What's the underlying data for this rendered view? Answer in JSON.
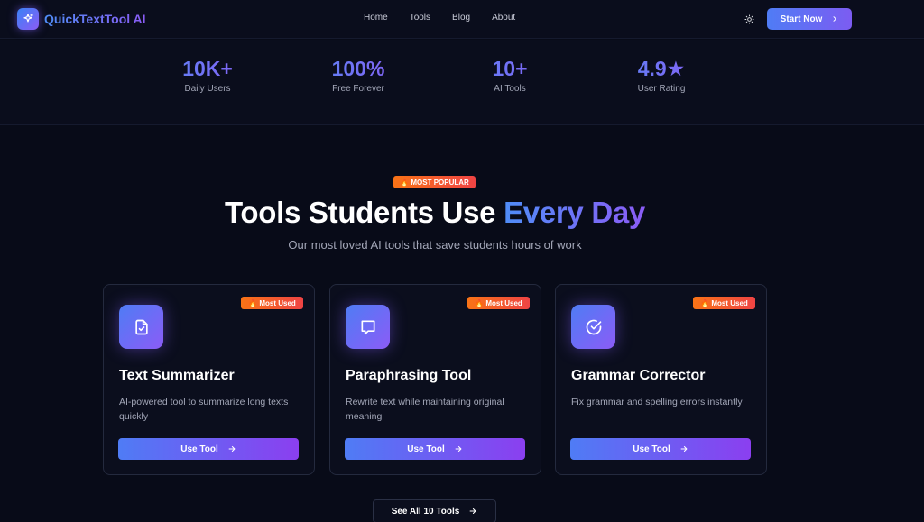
{
  "nav": {
    "brand": "QuickTextTool AI",
    "links": [
      "Home",
      "Tools",
      "Blog",
      "About"
    ],
    "cta_label": "Start Now"
  },
  "stats": [
    {
      "value": "10K+",
      "label": "Daily Users"
    },
    {
      "value": "100%",
      "label": "Free Forever"
    },
    {
      "value": "10+",
      "label": "AI Tools"
    },
    {
      "value": "4.9★",
      "label": "User Rating"
    }
  ],
  "hero": {
    "badge": "🔥 MOST POPULAR",
    "title_main": "Tools Students Use ",
    "title_accent": "Every Day",
    "subtitle": "Our most loved AI tools that save students hours of work"
  },
  "cards": [
    {
      "badge": "🔥 Most Used",
      "title": "Text Summarizer",
      "desc": "AI-powered tool to summarize long texts quickly",
      "button": "Use Tool",
      "icon": "document-check-icon"
    },
    {
      "badge": "🔥 Most Used",
      "title": "Paraphrasing Tool",
      "desc": "Rewrite text while maintaining original meaning",
      "button": "Use Tool",
      "icon": "chat-bubble-icon"
    },
    {
      "badge": "🔥 Most Used",
      "title": "Grammar Corrector",
      "desc": "Fix grammar and spelling errors instantly",
      "button": "Use Tool",
      "icon": "check-circle-icon"
    }
  ],
  "see_all": "See All 10 Tools",
  "colors": {
    "background": "#080b18",
    "accent_blue": "#4f7cf5",
    "accent_purple": "#8b5cf6",
    "badge_orange": "#f97316"
  }
}
